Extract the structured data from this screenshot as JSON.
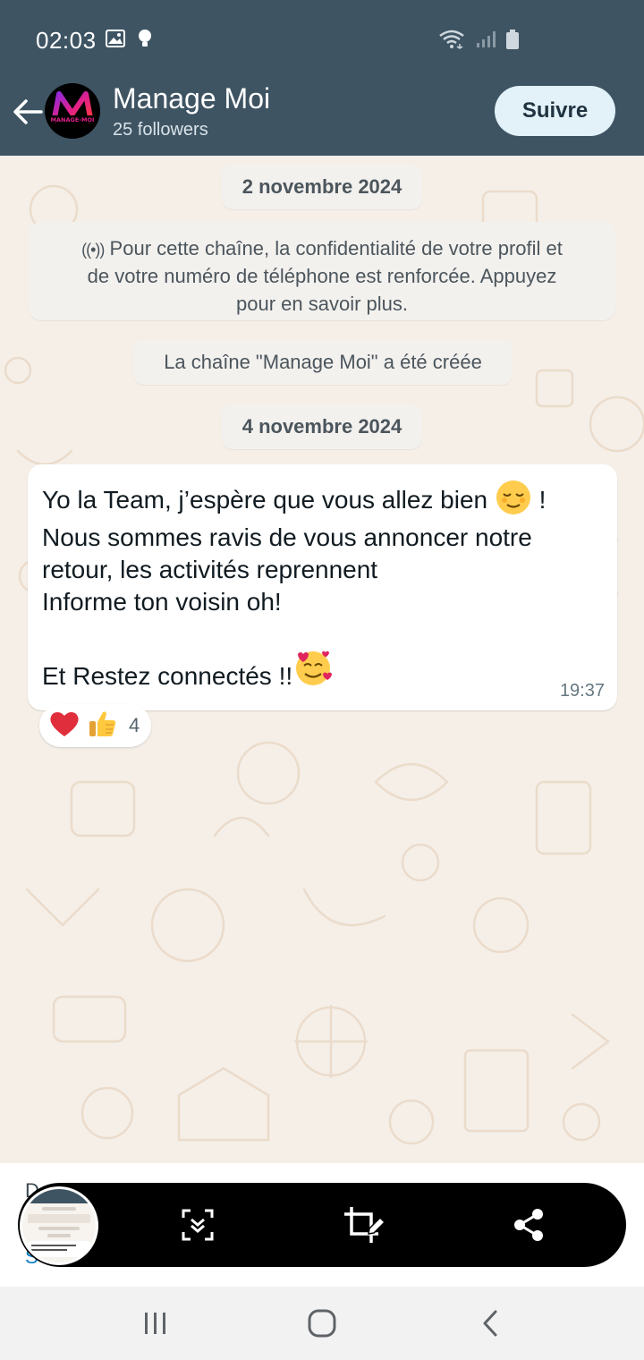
{
  "status_bar": {
    "time": "02:03",
    "icons_left": [
      "image-icon",
      "bulb-icon"
    ],
    "icons_right": [
      "wifi-icon",
      "signal-icon",
      "battery-icon"
    ]
  },
  "header": {
    "channel_name": "Manage Moi",
    "followers": "25 followers",
    "follow_label": "Suivre",
    "avatar_text": "MANAGE-MOI",
    "bg_color": "#3e5463"
  },
  "chat": {
    "date1": "2 novembre 2024",
    "privacy_notice": {
      "icon": "broadcast-icon",
      "lines": [
        "Pour cette chaîne, la confidentialité de votre profil et",
        "de votre numéro de téléphone est renforcée. Appuyez",
        "pour en savoir plus."
      ]
    },
    "created_notice": "La chaîne \"Manage Moi\" a été créée",
    "date2": "4 novembre 2024",
    "message": {
      "line1": "Yo la Team, j’espère que vous allez bien",
      "line1_suffix": "!",
      "line2": "Nous sommes ravis de vous annoncer notre",
      "line3": "retour, les activités reprennent",
      "line4": "Informe ton voisin oh!",
      "line5": "Et Restez connectés !!",
      "time": "19:37",
      "emojis": [
        "relieved-face-emoji",
        "smiling-face-with-hearts-emoji"
      ]
    },
    "reactions": {
      "icons": [
        "heart-icon",
        "thumbs-up-icon"
      ],
      "count": "4"
    }
  },
  "bottom": {
    "peek_text": "D",
    "peek_link": "S",
    "capture_actions": [
      "scroll-capture-icon",
      "crop-edit-icon",
      "share-icon"
    ]
  },
  "nav": {
    "buttons": [
      "recents-icon",
      "home-icon",
      "back-icon"
    ]
  }
}
